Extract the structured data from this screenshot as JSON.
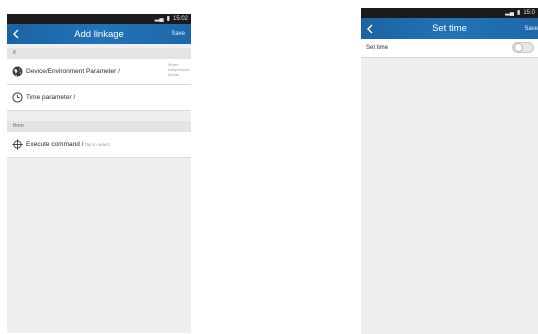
{
  "left": {
    "status": {
      "time": "15:02"
    },
    "nav": {
      "title": "Add linkage",
      "action": "Save"
    },
    "if_label": "if",
    "then_label": "then",
    "rows": {
      "device": {
        "label": "Device/Environment Parameter /",
        "side_hint": "When baby/sensor Model"
      },
      "time": {
        "label": "Time parameter /"
      },
      "execute": {
        "label": "Execute command /",
        "hint": "Tap to select"
      }
    },
    "icons": {
      "device": "globe-icon",
      "time": "clock-icon",
      "execute": "crosshair-icon",
      "back": "chevron-left-icon"
    }
  },
  "right": {
    "status": {
      "time": "15:0"
    },
    "nav": {
      "title": "Set time",
      "action": "Save"
    },
    "set_time": {
      "label": "Set time",
      "toggle_on": false
    },
    "icons": {
      "back": "chevron-left-icon"
    }
  },
  "colors": {
    "navbar": "#2173b8",
    "background": "#efeff1",
    "statusbar": "#1b1b1b"
  }
}
